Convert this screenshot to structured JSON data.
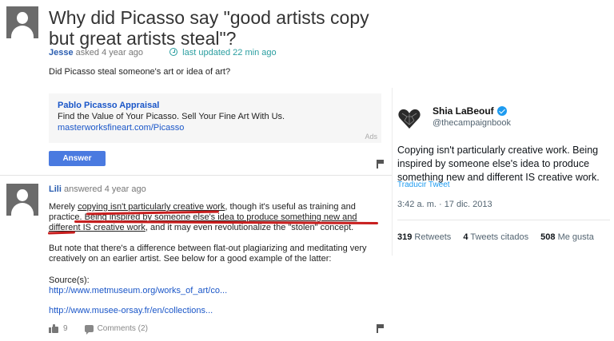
{
  "question": {
    "title": "Why did Picasso say \"good artists copy but great artists steal\"?",
    "author": "Jesse",
    "asked_text": "asked 4 year ago",
    "updated_text": "last updated 22 min ago",
    "body": "Did Picasso steal someone's art or idea of art?"
  },
  "ad": {
    "title": "Pablo Picasso Appraisal",
    "text": "Find the Value of Your Picasso. Sell Your Fine Art With Us.",
    "url": "masterworksfineart.com/Picasso",
    "label": "Ads"
  },
  "answer_button": "Answer",
  "answer": {
    "author": "Lili",
    "answered_text": "answered 4 year ago",
    "p1_a": "Merely ",
    "p1_b": "copying isn't particularly creative work",
    "p1_c": ", though it's useful as training and practice. ",
    "p1_d": "Being inspired by someone else's idea to produce something new and different IS creative work",
    "p1_e": ", and it may even revolutionalize the \"stolen\" concept.",
    "p2": "But note that there's a difference between flat-out plagiarizing and meditating very creatively on an earlier artist. See below for a good example of the latter:",
    "sources_label": "Source(s):",
    "link1": "http://www.metmuseum.org/works_of_art/co...",
    "link2": "http://www.musee-orsay.fr/en/collections...",
    "likes": "9",
    "comments": "Comments (2)"
  },
  "tweet": {
    "name": "Shia LaBeouf",
    "handle": "@thecampaignbook",
    "text": "Copying isn't particularly creative work. Being inspired by someone else's idea to produce something new and different IS creative work.",
    "translate": "Traducir Tweet",
    "time": "3:42 a. m. · 17 dic. 2013",
    "retweets_count": "319",
    "retweets_label": "Retweets",
    "quotes_count": "4",
    "quotes_label": "Tweets citados",
    "likes_count": "508",
    "likes_label": "Me gusta"
  },
  "colors": {
    "link": "#1a56c8",
    "accent_teal": "#2a9ea0",
    "answer_button": "#4a7ae0",
    "highlight_red": "#c81e1e",
    "twitter_blue": "#1d9bf0"
  },
  "icons": [
    "user-avatar-icon",
    "clock-icon",
    "flag-icon",
    "thumbs-up-icon",
    "comment-icon",
    "verified-badge-icon",
    "heart-logo-avatar"
  ]
}
